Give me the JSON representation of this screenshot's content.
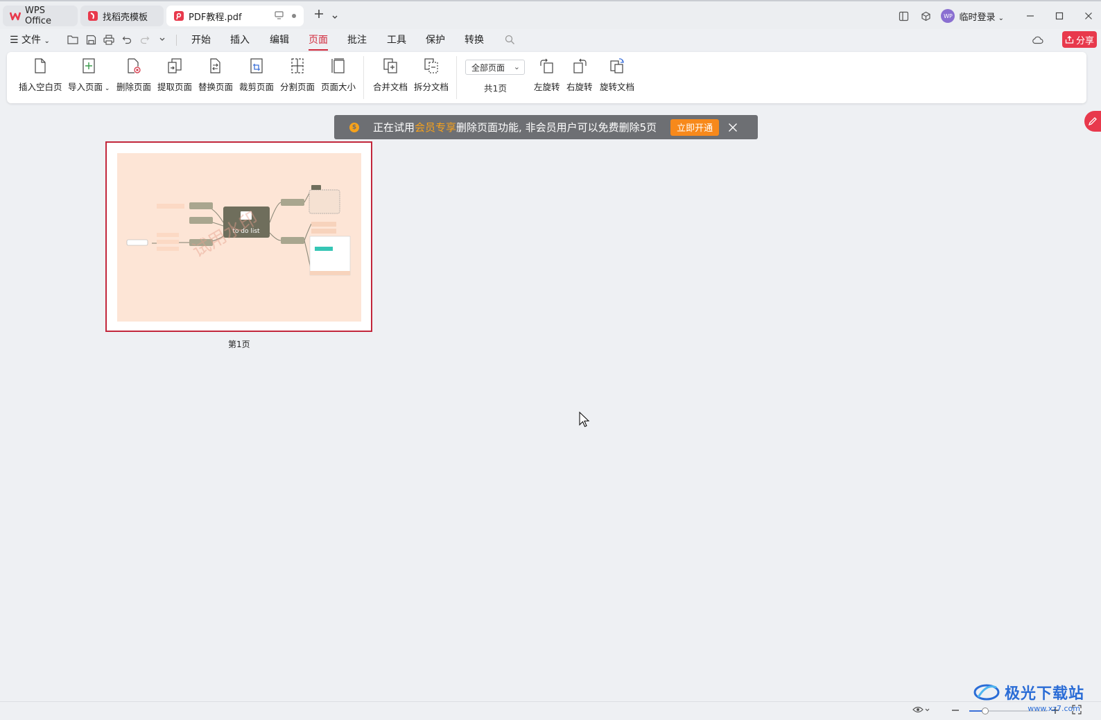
{
  "titlebar": {
    "tabs": [
      {
        "label": "WPS Office",
        "icon": "wps-logo-icon"
      },
      {
        "label": "找稻壳模板",
        "icon": "daoke-icon"
      },
      {
        "label": "PDF教程.pdf",
        "icon": "pdf-icon"
      }
    ],
    "login": "临时登录",
    "avatar_text": "WP"
  },
  "menubar": {
    "file": "文件",
    "items": [
      "开始",
      "插入",
      "编辑",
      "页面",
      "批注",
      "工具",
      "保护",
      "转换"
    ],
    "active": "页面",
    "share": "分享"
  },
  "ribbon": {
    "buttons": [
      {
        "label": "插入空白页",
        "icon": "blank-page-icon"
      },
      {
        "label": "导入页面",
        "icon": "import-page-icon",
        "dropdown": true
      },
      {
        "label": "删除页面",
        "icon": "delete-page-icon"
      },
      {
        "label": "提取页面",
        "icon": "extract-page-icon"
      },
      {
        "label": "替换页面",
        "icon": "replace-page-icon"
      },
      {
        "label": "裁剪页面",
        "icon": "crop-page-icon"
      },
      {
        "label": "分割页面",
        "icon": "split-page-icon"
      },
      {
        "label": "页面大小",
        "icon": "page-size-icon"
      },
      {
        "label": "合并文档",
        "icon": "merge-doc-icon"
      },
      {
        "label": "拆分文档",
        "icon": "split-doc-icon"
      },
      {
        "label": "左旋转",
        "icon": "rotate-left-icon"
      },
      {
        "label": "右旋转",
        "icon": "rotate-right-icon"
      },
      {
        "label": "旋转文档",
        "icon": "rotate-doc-icon"
      }
    ],
    "page_range": "全部页面",
    "page_count": "共1页"
  },
  "toast": {
    "prefix": "正在试用",
    "highlight": "会员专享",
    "suffix": "删除页面功能, 非会员用户可以免费删除5页",
    "button": "立即开通"
  },
  "document": {
    "page_label": "第1页",
    "thumbnail_title": "to do list",
    "thumbnail_watermark": "试用水印"
  },
  "watermark": {
    "text": "极光下载站",
    "url": "www.xz7.com"
  },
  "colors": {
    "accent": "#d12a3c",
    "toast_bg": "#6d6f73",
    "toast_highlight": "#f7a21b",
    "toast_button": "#f7891b",
    "thumbnail_bg": "#fde5d6"
  }
}
